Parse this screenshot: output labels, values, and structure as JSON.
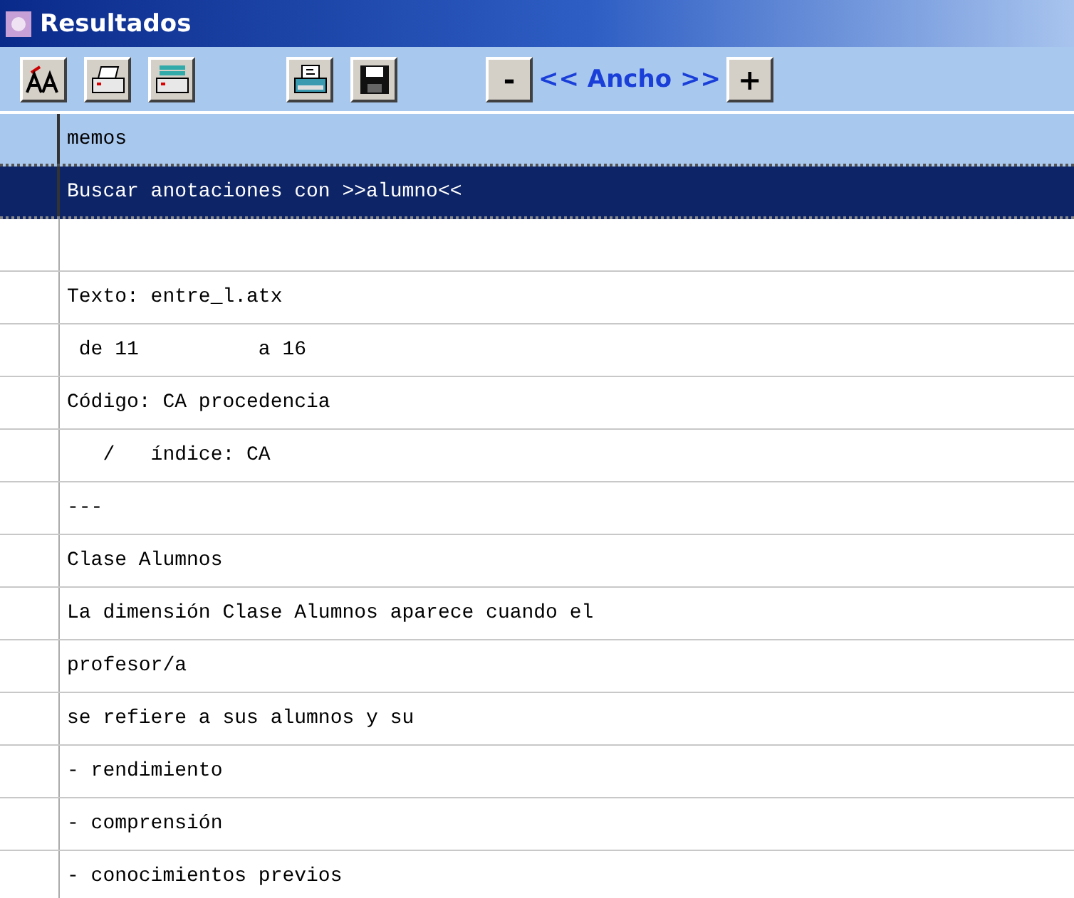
{
  "window": {
    "title": "Resultados"
  },
  "toolbar": {
    "buttons": [
      {
        "kind": "font"
      },
      {
        "kind": "print"
      },
      {
        "kind": "print-setup"
      },
      {
        "kind": "gap"
      },
      {
        "kind": "print-preview"
      },
      {
        "kind": "save"
      }
    ],
    "width_control": {
      "decrease": "-",
      "label": "<< Ancho >>",
      "increase": "+"
    }
  },
  "table": {
    "columns": [
      "memos"
    ],
    "rows": [
      {
        "text": "Buscar anotaciones con >>alumno<<",
        "selected": true
      },
      {
        "selected": false
      },
      {
        "text": "Texto: entre_l.atx",
        "selected": false
      },
      {
        "text": " de 11          a 16",
        "selected": false
      },
      {
        "text": "Código: CA procedencia",
        "selected": false
      },
      {
        "text": "   /   índice: CA",
        "selected": false
      },
      {
        "text": "---",
        "selected": false
      },
      {
        "text": "Clase Alumnos",
        "selected": false
      },
      {
        "text": "La dimensión Clase Alumnos aparece cuando el",
        "selected": false
      },
      {
        "text": "profesor/a",
        "selected": false
      },
      {
        "text": "se refiere a sus alumnos y su",
        "selected": false
      },
      {
        "text": "- rendimiento",
        "selected": false
      },
      {
        "text": "- comprensión",
        "selected": false
      },
      {
        "text": "- conocimientos previos",
        "selected": false
      }
    ]
  }
}
